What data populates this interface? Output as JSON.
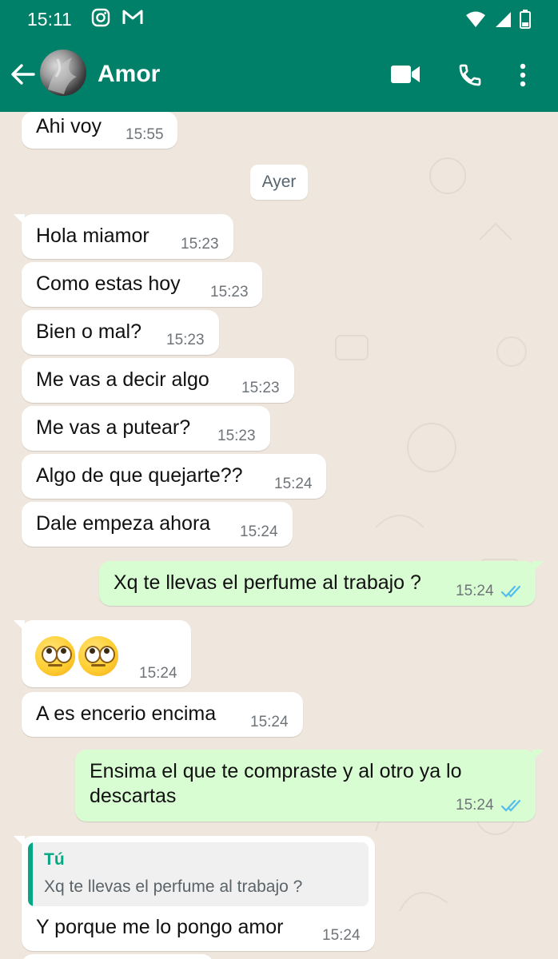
{
  "status_bar": {
    "time": "15:11",
    "left_icons": [
      "instagram-icon",
      "gmail-icon"
    ],
    "right_icons": [
      "wifi-icon",
      "signal-icon",
      "battery-icon"
    ]
  },
  "header": {
    "contact_name": "Amor",
    "actions": [
      "video-call-icon",
      "voice-call-icon",
      "more-options-icon"
    ]
  },
  "date_separator": "Ayer",
  "messages": [
    {
      "dir": "in",
      "text": "Ahi voy",
      "time": "15:55"
    },
    {
      "dir": "in",
      "text": "Hola miamor",
      "time": "15:23"
    },
    {
      "dir": "in",
      "text": "Como estas hoy",
      "time": "15:23"
    },
    {
      "dir": "in",
      "text": "Bien o mal?",
      "time": "15:23"
    },
    {
      "dir": "in",
      "text": "Me vas a decir algo",
      "time": "15:23"
    },
    {
      "dir": "in",
      "text": "Me vas a putear?",
      "time": "15:23"
    },
    {
      "dir": "in",
      "text": "Algo de que quejarte??",
      "time": "15:24"
    },
    {
      "dir": "in",
      "text": "Dale empeza ahora",
      "time": "15:24"
    },
    {
      "dir": "out",
      "text": "Xq te llevas el perfume al trabajo ?",
      "time": "15:24",
      "status": "read"
    },
    {
      "dir": "in",
      "text": "🙄🙄",
      "time": "15:24",
      "emoji_names": [
        "face-with-rolling-eyes",
        "face-with-rolling-eyes"
      ]
    },
    {
      "dir": "in",
      "text": "A es encerio encima",
      "time": "15:24"
    },
    {
      "dir": "out",
      "line1": "Ensima el que te compraste y al otro ya lo",
      "line2": "descartas",
      "time": "15:24",
      "status": "read"
    },
    {
      "dir": "in",
      "quote_author": "Tú",
      "quote_text": "Xq te llevas el perfume al trabajo ?",
      "text": "Y porque me lo pongo amor",
      "time": "15:24"
    }
  ],
  "colors": {
    "header": "#008069",
    "chat_bg": "#efe7dd",
    "incoming": "#ffffff",
    "outgoing": "#d9fdd3",
    "read_ticks": "#53bdeb",
    "quote_accent": "#06a884"
  }
}
